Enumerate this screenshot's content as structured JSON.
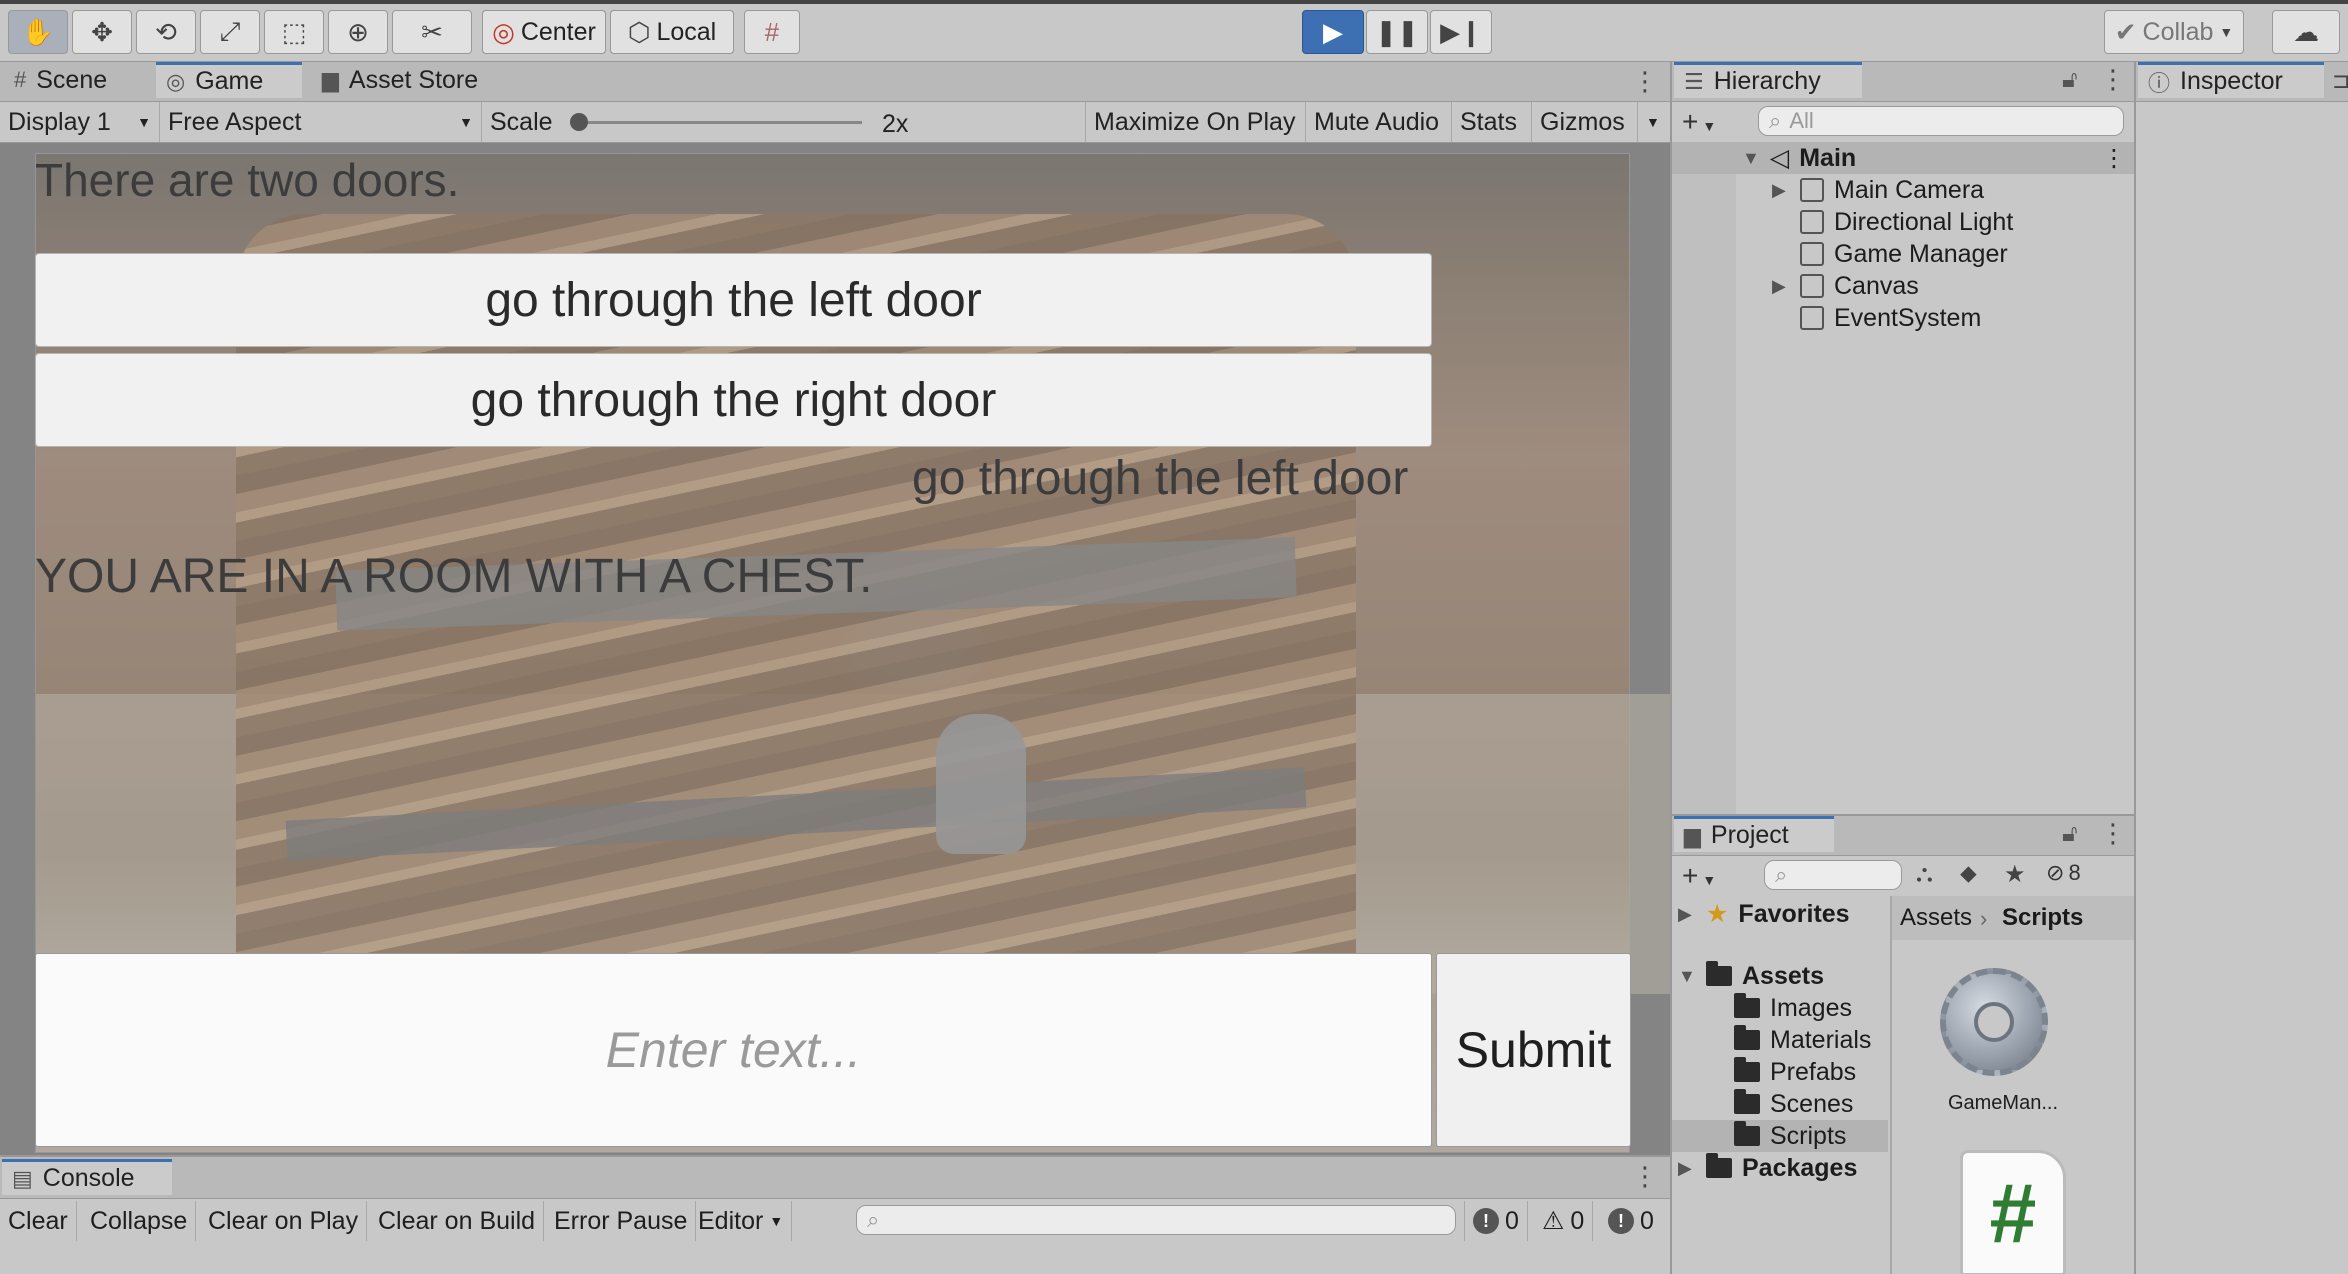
{
  "toolbar": {
    "tools": [
      "hand-icon",
      "move-icon",
      "rotate-icon",
      "scale-icon",
      "rect-tool-icon",
      "transform-icon",
      "custom-tool-icon"
    ],
    "pivot_label": "Center",
    "space_label": "Local",
    "collab_label": "Collab"
  },
  "scene_tabs": [
    "Scene",
    "Game",
    "Asset Store"
  ],
  "game_bar": {
    "display": "Display 1",
    "aspect": "Free Aspect",
    "scale_label": "Scale",
    "scale_value": "2x",
    "maximize": "Maximize On Play",
    "mute": "Mute Audio",
    "stats": "Stats",
    "gizmos": "Gizmos"
  },
  "game": {
    "header_text": "There are two doors.",
    "choices": [
      "go through the left door",
      "go through the right door"
    ],
    "echo_text": "go through the left door",
    "room_text": "YOU ARE IN A ROOM WITH A CHEST.",
    "input_placeholder": "Enter text...",
    "submit_label": "Submit"
  },
  "hierarchy": {
    "tab": "Hierarchy",
    "search_placeholder": "All",
    "scene": "Main",
    "items": [
      "Main Camera",
      "Directional Light",
      "Game Manager",
      "Canvas",
      "EventSystem"
    ]
  },
  "inspector": {
    "tab": "Inspector"
  },
  "project": {
    "tab": "Project",
    "hidden_count": "8",
    "favorites": "Favorites",
    "assets": "Assets",
    "asset_folders": [
      "Images",
      "Materials",
      "Prefabs",
      "Scenes",
      "Scripts"
    ],
    "packages": "Packages",
    "breadcrumb_root": "Assets",
    "breadcrumb_current": "Scripts",
    "file1": "GameMan...",
    "file2_glyph": "#"
  },
  "console": {
    "tab": "Console",
    "buttons": [
      "Clear",
      "Collapse",
      "Clear on Play",
      "Clear on Build",
      "Error Pause",
      "Editor"
    ],
    "counts": [
      "0",
      "0",
      "0"
    ]
  }
}
